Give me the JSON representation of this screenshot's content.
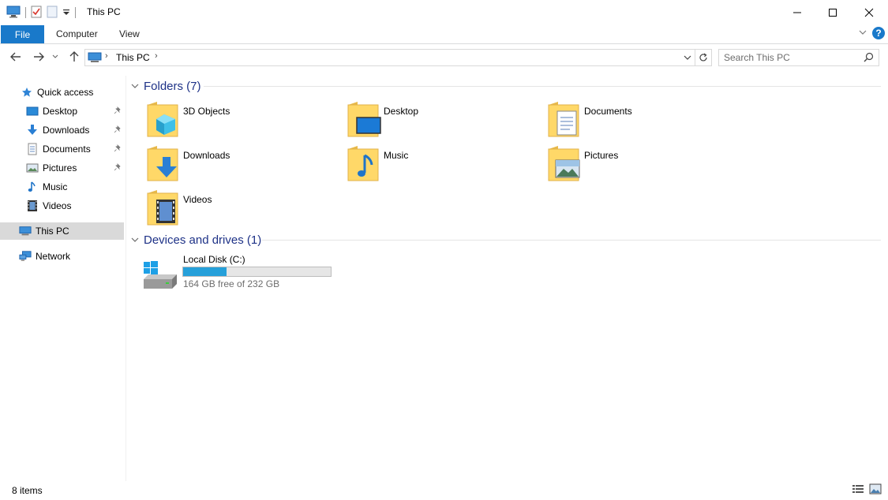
{
  "window": {
    "title": "This PC",
    "controls": {
      "minimize_icon": "minimize-icon",
      "maximize_icon": "maximize-icon",
      "close_icon": "close-icon"
    }
  },
  "ribbon": {
    "tabs": [
      {
        "label": "File",
        "active": true
      },
      {
        "label": "Computer"
      },
      {
        "label": "View"
      }
    ],
    "accent_color": "#1979ca",
    "help_label": "?"
  },
  "navigation": {
    "address_path": "This PC",
    "search_placeholder": "Search This PC"
  },
  "sidebar": {
    "quick_access_label": "Quick access",
    "quick_items": [
      {
        "label": "Desktop",
        "icon": "desktop-icon",
        "pinned": true
      },
      {
        "label": "Downloads",
        "icon": "downloads-icon",
        "pinned": true
      },
      {
        "label": "Documents",
        "icon": "documents-icon",
        "pinned": true
      },
      {
        "label": "Pictures",
        "icon": "pictures-icon",
        "pinned": true
      },
      {
        "label": "Music",
        "icon": "music-icon",
        "pinned": false
      },
      {
        "label": "Videos",
        "icon": "videos-icon",
        "pinned": false
      }
    ],
    "this_pc_label": "This PC",
    "network_label": "Network"
  },
  "content": {
    "folders_header": "Folders (7)",
    "folders": [
      {
        "label": "3D Objects",
        "icon": "3d-objects-icon"
      },
      {
        "label": "Desktop",
        "icon": "desktop-icon"
      },
      {
        "label": "Documents",
        "icon": "documents-icon"
      },
      {
        "label": "Downloads",
        "icon": "downloads-icon"
      },
      {
        "label": "Music",
        "icon": "music-icon"
      },
      {
        "label": "Pictures",
        "icon": "pictures-icon"
      },
      {
        "label": "Videos",
        "icon": "videos-icon"
      }
    ],
    "drives_header": "Devices and drives (1)",
    "drives": [
      {
        "label": "Local Disk (C:)",
        "free_text": "164 GB free of 232 GB",
        "used_fraction": 0.293
      }
    ]
  },
  "status": {
    "items_text": "8 items"
  }
}
